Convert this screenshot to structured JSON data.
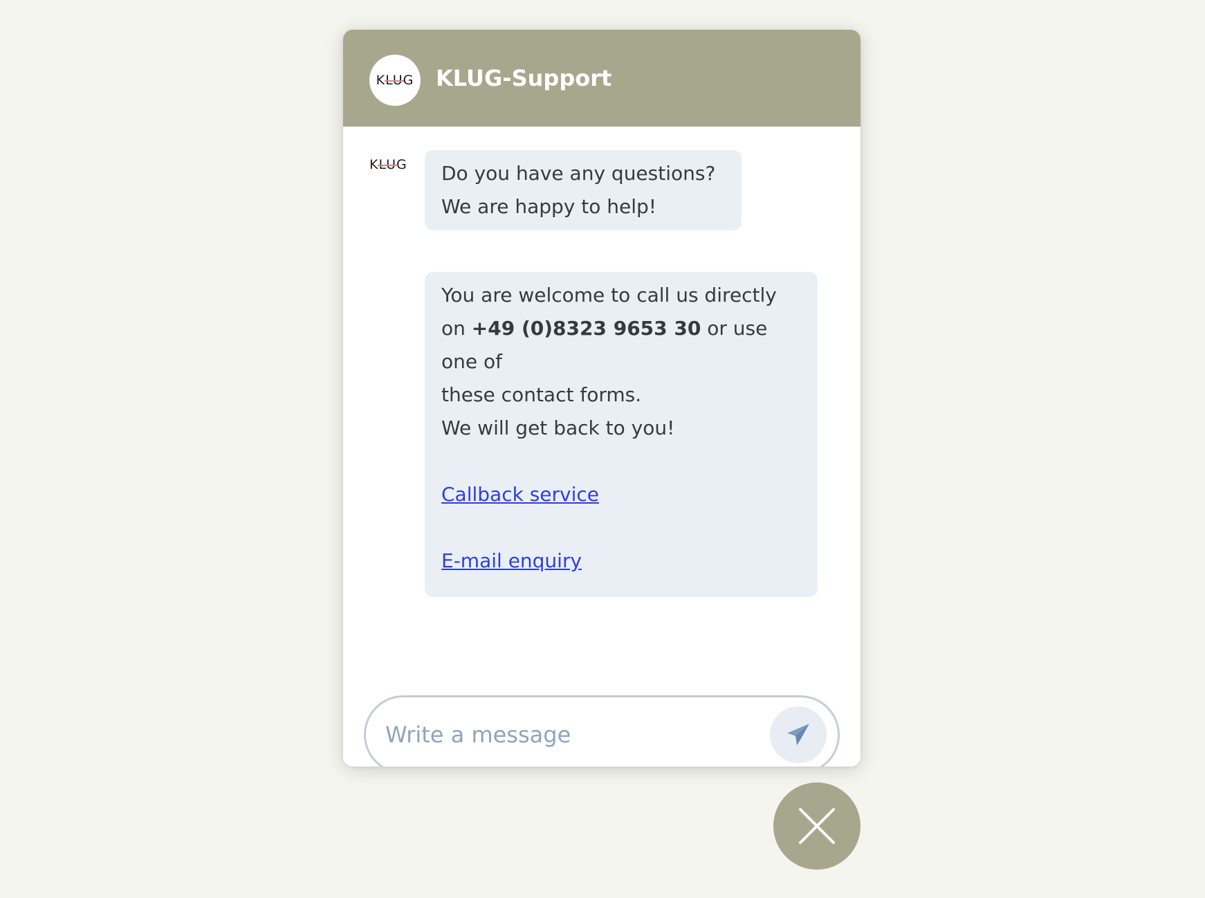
{
  "header": {
    "logo_text": "KLUG",
    "title": "KLUG-Support"
  },
  "messages": [
    {
      "text": "Do you have any questions? We are happy to help!"
    },
    {
      "line1": "You are welcome to call us directly",
      "line2_prefix": "on ",
      "phone": "+49 (0)8323 9653 30",
      "line2_suffix": " or use one of",
      "line3": "these contact forms.",
      "line4": "We will get back to you!",
      "links": [
        {
          "label": "Callback service"
        },
        {
          "label": "E-mail enquiry"
        }
      ]
    }
  ],
  "composer": {
    "placeholder": "Write a message"
  },
  "colors": {
    "brand": "#a6a78c",
    "bubble": "#eaeff5",
    "link": "#2c3fe0",
    "placeholder": "#8fa4bd"
  },
  "icons": {
    "send": "paper-plane-icon",
    "close": "close-icon"
  }
}
